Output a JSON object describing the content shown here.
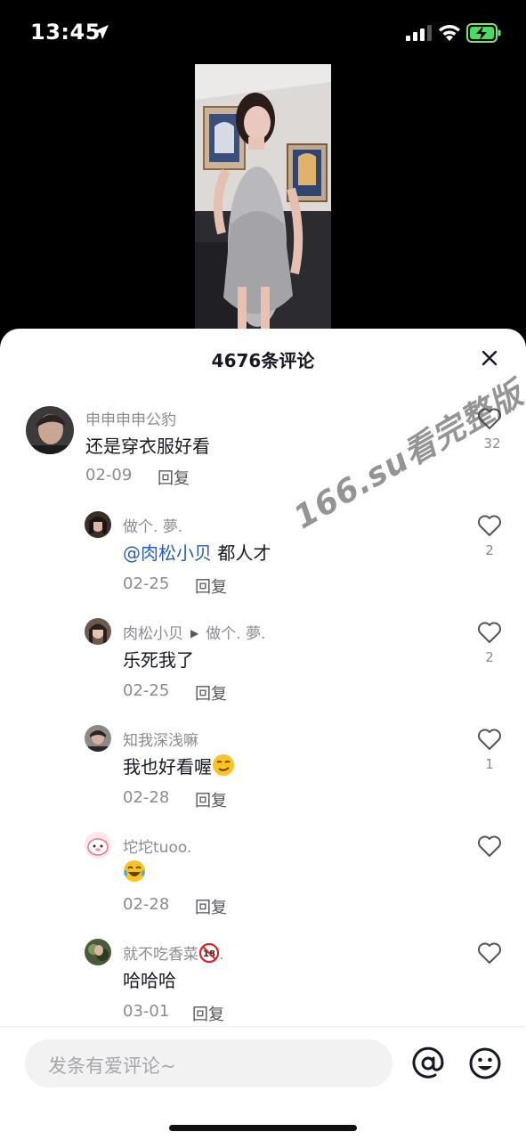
{
  "status_bar": {
    "time": "13:45"
  },
  "video": {
    "description": ""
  },
  "comments_sheet": {
    "title": "4676条评论",
    "watermark": "166.su看完整版",
    "comments": [
      {
        "user": "申申申申公豹",
        "text": "还是穿衣服好看",
        "date": "02-09",
        "reply": "回复",
        "likes": "32"
      },
      {
        "user": "做个. 夢.",
        "mention": "@肉松小贝",
        "text": " 都人才",
        "date": "02-25",
        "reply": "回复",
        "likes": "2"
      },
      {
        "user": "肉松小贝",
        "reply_to": "做个. 夢.",
        "text": "乐死我了",
        "date": "02-25",
        "reply": "回复",
        "likes": "2"
      },
      {
        "user": "知我深浅嘛",
        "text": "我也好看喔",
        "date": "02-28",
        "reply": "回复",
        "likes": "1"
      },
      {
        "user": "坨坨tuoo.",
        "text": "",
        "date": "02-28",
        "reply": "回复",
        "likes": ""
      },
      {
        "user": "就不吃香菜",
        "user_suffix": ".",
        "text": "哈哈哈",
        "date": "03-01",
        "reply": "回复",
        "likes": ""
      }
    ]
  },
  "input_bar": {
    "placeholder": "发条有爱评论~"
  },
  "colors": {
    "accent_link": "#2a5db0",
    "text_primary": "#161823",
    "text_secondary": "#8a8b91"
  }
}
